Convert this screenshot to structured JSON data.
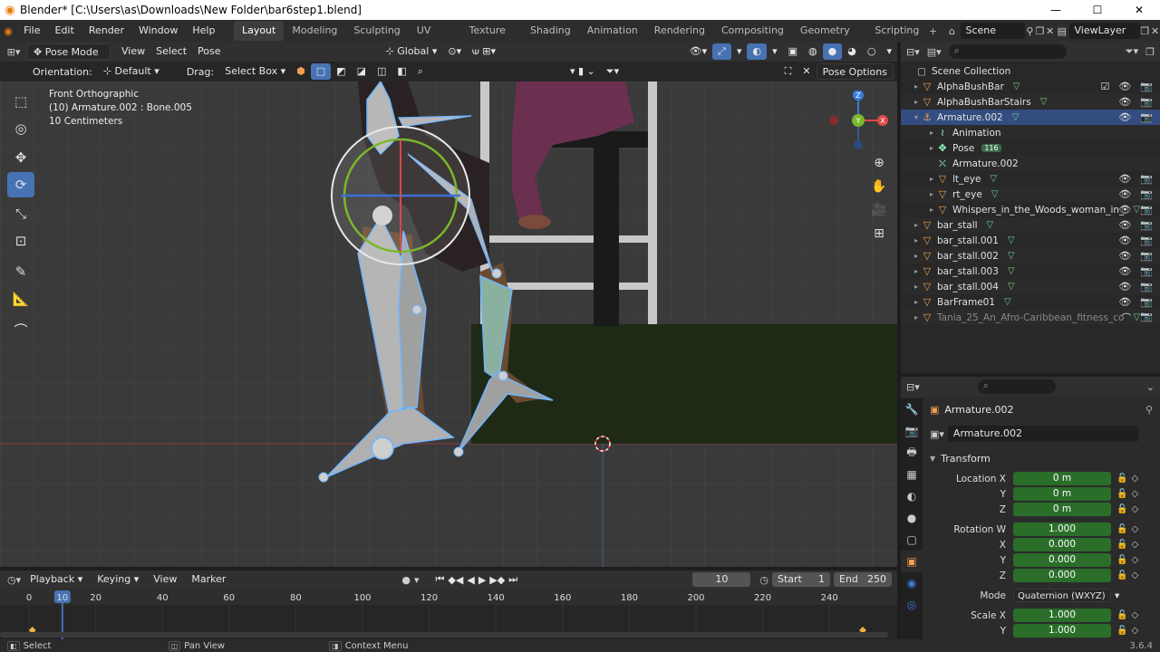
{
  "titlebar": {
    "title": "Blender* [C:\\Users\\as\\Downloads\\New Folder\\bar6step1.blend]",
    "minimize": "—",
    "maximize": "☐",
    "close": "✕"
  },
  "menus": [
    "File",
    "Edit",
    "Render",
    "Window",
    "Help"
  ],
  "workspaces": [
    "Layout",
    "Modeling",
    "Sculpting",
    "UV Editing",
    "Texture Paint",
    "Shading",
    "Animation",
    "Rendering",
    "Compositing",
    "Geometry Nodes",
    "Scripting"
  ],
  "active_workspace": "Layout",
  "scene_name": "Scene",
  "viewlayer_name": "ViewLayer",
  "viewport_header": {
    "mode": "Pose Mode",
    "menus": [
      "View",
      "Select",
      "Pose"
    ],
    "transform_orientation": "Global"
  },
  "viewport_header2": {
    "orientation_label": "Orientation:",
    "orientation_value": "Default",
    "drag_label": "Drag:",
    "drag_value": "Select Box",
    "pose_options": "Pose Options"
  },
  "viewport_info": {
    "view": "Front Orthographic",
    "object": "(10) Armature.002 : Bone.005",
    "scale": "10 Centimeters"
  },
  "navigation_gizmo": {
    "x": "X",
    "y": "Y",
    "z": "Z"
  },
  "outliner": {
    "collection": "Scene Collection",
    "rows": [
      {
        "name": "AlphaBushBar",
        "indent": 0,
        "icon": "mesh-icon",
        "checkbox": true,
        "visible": true
      },
      {
        "name": "AlphaBushBarStairs",
        "indent": 0,
        "icon": "mesh-icon",
        "visible": true
      },
      {
        "name": "Armature.002",
        "indent": 0,
        "icon": "armature-icon",
        "selected": true,
        "visible": true
      },
      {
        "name": "Animation",
        "indent": 1,
        "icon": "action-icon"
      },
      {
        "name": "Pose",
        "indent": 1,
        "icon": "pose-icon",
        "badge": "116"
      },
      {
        "name": "Armature.002",
        "indent": 1,
        "icon": "armature-data-icon"
      },
      {
        "name": "lt_eye",
        "indent": 1,
        "icon": "mesh-icon",
        "visible": true
      },
      {
        "name": "rt_eye",
        "indent": 1,
        "icon": "mesh-icon",
        "visible": true
      },
      {
        "name": "Whispers_in_the_Woods_woman_in_",
        "indent": 1,
        "icon": "mesh-icon",
        "visible": true
      },
      {
        "name": "bar_stall",
        "indent": 0,
        "icon": "mesh-icon",
        "visible": true
      },
      {
        "name": "bar_stall.001",
        "indent": 0,
        "icon": "mesh-icon",
        "visible": true
      },
      {
        "name": "bar_stall.002",
        "indent": 0,
        "icon": "mesh-icon",
        "visible": true
      },
      {
        "name": "bar_stall.003",
        "indent": 0,
        "icon": "mesh-icon",
        "visible": true
      },
      {
        "name": "bar_stall.004",
        "indent": 0,
        "icon": "mesh-icon",
        "visible": true
      },
      {
        "name": "BarFrame01",
        "indent": 0,
        "icon": "mesh-icon",
        "visible": true
      },
      {
        "name": "Tania_25_An_Afro-Caribbean_fitness_co",
        "indent": 0,
        "icon": "mesh-icon",
        "dim": true,
        "hidden": true
      }
    ]
  },
  "properties": {
    "object_name": "Armature.002",
    "datablock": "Armature.002",
    "panel_title": "Transform",
    "fields": [
      {
        "label": "Location X",
        "value": "0 m"
      },
      {
        "label": "Y",
        "value": "0 m"
      },
      {
        "label": "Z",
        "value": "0 m"
      },
      {
        "label": "Rotation W",
        "value": "1.000"
      },
      {
        "label": "X",
        "value": "0.000"
      },
      {
        "label": "Y",
        "value": "0.000"
      },
      {
        "label": "Z",
        "value": "0.000"
      }
    ],
    "mode_label": "Mode",
    "mode_value": "Quaternion (WXYZ)",
    "scale_fields": [
      {
        "label": "Scale X",
        "value": "1.000"
      },
      {
        "label": "Y",
        "value": "1.000"
      }
    ]
  },
  "timeline": {
    "menus": [
      "Playback",
      "Keying",
      "View",
      "Marker"
    ],
    "current_frame": "10",
    "start_label": "Start",
    "start": "1",
    "end_label": "End",
    "end": "250",
    "ruler": [
      "0",
      "10",
      "20",
      "40",
      "60",
      "80",
      "100",
      "120",
      "140",
      "160",
      "180",
      "200",
      "220",
      "240"
    ]
  },
  "statusbar": {
    "select": "Select",
    "pan": "Pan View",
    "context": "Context Menu",
    "version": "3.6.4"
  }
}
